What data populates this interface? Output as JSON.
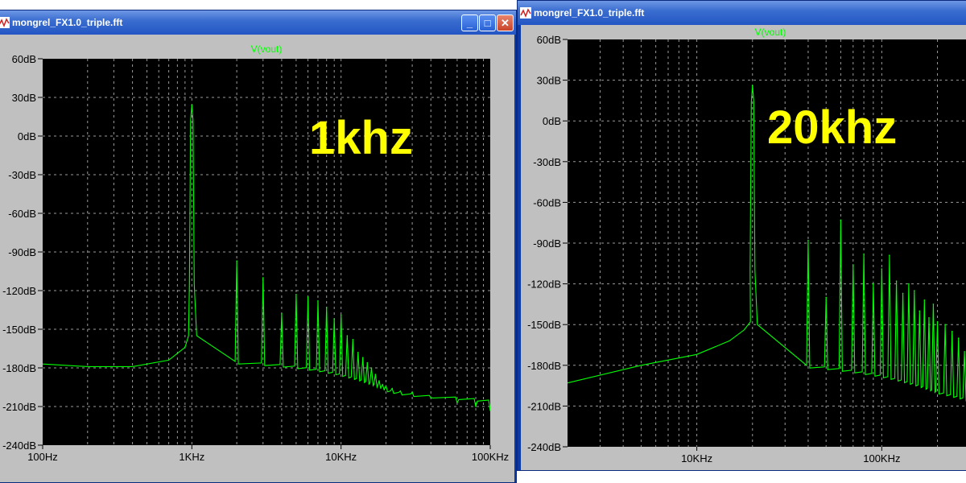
{
  "windows": [
    {
      "title": "mongrel_FX1.0_triple.fft",
      "buttons": [
        "minimize",
        "maximize",
        "close"
      ]
    },
    {
      "title": "mongrel_FX1.0_triple.fft",
      "buttons": []
    }
  ],
  "colors": {
    "trace": "#00ff00",
    "plot_bg": "#000000",
    "grid": "#9a9a9a",
    "annotation": "#ffff00"
  },
  "chart_data": [
    {
      "type": "line",
      "title": "V(vout)",
      "annotation": "1khz",
      "x_scale": "log",
      "xlim": [
        100,
        100000
      ],
      "ylim": [
        -240,
        60
      ],
      "yticks": [
        "60dB",
        "30dB",
        "0dB",
        "-30dB",
        "-60dB",
        "-90dB",
        "-120dB",
        "-150dB",
        "-180dB",
        "-210dB",
        "-240dB"
      ],
      "xticks": [
        {
          "value": 100,
          "label": "100Hz"
        },
        {
          "value": 1000,
          "label": "1KHz"
        },
        {
          "value": 10000,
          "label": "10KHz"
        },
        {
          "value": 100000,
          "label": "100KHz"
        }
      ],
      "grid": true,
      "floor": [
        [
          100,
          -177
        ],
        [
          200,
          -179
        ],
        [
          400,
          -179
        ],
        [
          700,
          -174
        ],
        [
          900,
          -164
        ],
        [
          950,
          -155
        ]
      ],
      "fundamental": {
        "freq": 1000,
        "peak": 24,
        "base": -155
      },
      "harmonics": [
        [
          2000,
          -97
        ],
        [
          3000,
          -110
        ],
        [
          4000,
          -138
        ],
        [
          5000,
          -123
        ],
        [
          6000,
          -125
        ],
        [
          7000,
          -128
        ],
        [
          8000,
          -133
        ],
        [
          9000,
          -142
        ],
        [
          10000,
          -139
        ],
        [
          11000,
          -155
        ],
        [
          12000,
          -158
        ],
        [
          13000,
          -168
        ],
        [
          14000,
          -172
        ],
        [
          15000,
          -176
        ],
        [
          16000,
          -180
        ],
        [
          17000,
          -185
        ],
        [
          18000,
          -190
        ],
        [
          19000,
          -193
        ],
        [
          20000,
          -194
        ],
        [
          22000,
          -196
        ],
        [
          25000,
          -198
        ],
        [
          30000,
          -199
        ],
        [
          40000,
          -203
        ],
        [
          60000,
          -207
        ],
        [
          80000,
          -210
        ],
        [
          100000,
          -213
        ]
      ]
    },
    {
      "type": "line",
      "title": "V(vout)",
      "annotation": "20khz",
      "x_scale": "log",
      "xlim": [
        2000,
        300000
      ],
      "ylim": [
        -240,
        60
      ],
      "yticks": [
        "60dB",
        "30dB",
        "0dB",
        "-30dB",
        "-60dB",
        "-90dB",
        "-120dB",
        "-150dB",
        "-180dB",
        "-210dB",
        "-240dB"
      ],
      "xticks": [
        {
          "value": 10000,
          "label": "10KHz"
        },
        {
          "value": 100000,
          "label": "100KHz"
        }
      ],
      "grid": true,
      "floor": [
        [
          2000,
          -193
        ],
        [
          5000,
          -180
        ],
        [
          10000,
          -172
        ],
        [
          15000,
          -162
        ],
        [
          18000,
          -154
        ],
        [
          19500,
          -148
        ]
      ],
      "fundamental": {
        "freq": 20000,
        "peak": 26,
        "base": -150
      },
      "harmonics": [
        [
          40000,
          -88
        ],
        [
          50000,
          -130
        ],
        [
          60000,
          -73
        ],
        [
          70000,
          -106
        ],
        [
          80000,
          -98
        ],
        [
          90000,
          -120
        ],
        [
          100000,
          -109
        ],
        [
          110000,
          -99
        ],
        [
          120000,
          -118
        ],
        [
          130000,
          -127
        ],
        [
          140000,
          -120
        ],
        [
          150000,
          -125
        ],
        [
          160000,
          -140
        ],
        [
          170000,
          -132
        ],
        [
          180000,
          -145
        ],
        [
          190000,
          -135
        ],
        [
          200000,
          -148
        ],
        [
          220000,
          -150
        ],
        [
          240000,
          -155
        ],
        [
          260000,
          -160
        ],
        [
          280000,
          -170
        ],
        [
          300000,
          -178
        ]
      ]
    }
  ]
}
